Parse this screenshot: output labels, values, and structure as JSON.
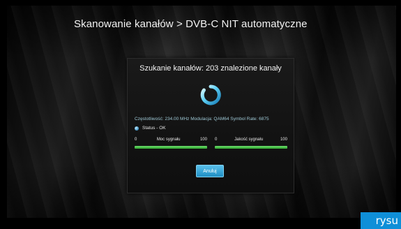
{
  "header": {
    "title": "Skanowanie kanałów > DVB-C NIT automatyczne"
  },
  "dialog": {
    "title": "Szukanie kanałów: 203 znalezione kanały",
    "spinner_icon": "loading-spinner-icon",
    "info": "Częstotliwość: 234.00 MHz Modulacja: QAM64 Symbol Rate: 6875",
    "status": "Status - OK",
    "signal_strength": {
      "min": "0",
      "label": "Moc sygnału",
      "max": "100",
      "level_percent": 100
    },
    "signal_quality": {
      "min": "0",
      "label": "Jakość sygnału",
      "max": "100",
      "level_percent": 100
    },
    "cancel_label": "Anuluj"
  },
  "colors": {
    "accent": "#1f8ec4",
    "meter_fill": "#2ea32e",
    "info_text": "#9fc9d6"
  },
  "watermark": {
    "text": "rysu"
  }
}
